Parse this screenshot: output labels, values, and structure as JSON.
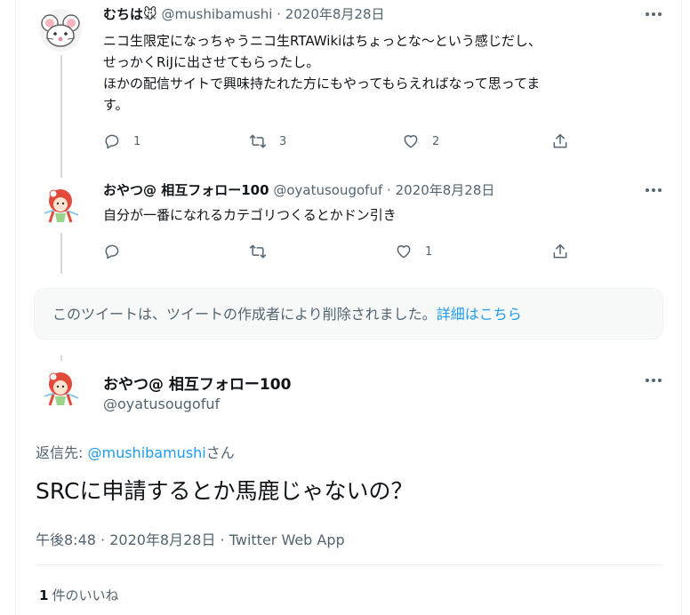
{
  "tweets": [
    {
      "name": "むちは🐭",
      "handle": "@mushibamushi",
      "dot": "·",
      "date": "2020年8月28日",
      "lines": [
        "ニコ生限定になっちゃうニコ生RTAWikiはちょっとな〜という感じだし、",
        "せっかくRiJに出させてもらったし。",
        "ほかの配信サイトで興味持たれた方にもやってもらえればなって思ってま",
        "す。"
      ],
      "reply_count": "1",
      "retweet_count": "3",
      "like_count": "2"
    },
    {
      "name": "おやつ@ 相互フォロー100",
      "handle": "@oyatusougofuf",
      "dot": "·",
      "date": "2020年8月28日",
      "lines": [
        "自分が一番になれるカテゴリつくるとかドン引き"
      ],
      "reply_count": "",
      "retweet_count": "",
      "like_count": "1"
    }
  ],
  "deleted_notice": {
    "text": "このツイートは、ツイートの作成者により削除されました。",
    "link": "詳細はこちら"
  },
  "main_tweet": {
    "name": "おやつ@ 相互フォロー100",
    "handle": "@oyatusougofuf",
    "reply_prefix": "返信先: ",
    "reply_handle": "@mushibamushi",
    "reply_suffix": "さん",
    "text": "SRCに申請するとか馬鹿じゃないの？",
    "time": "午後8:48",
    "date": "2020年8月28日",
    "client": "Twitter Web App",
    "sep": " · ",
    "likes_count": "1",
    "likes_label": "件のいいね"
  },
  "icons": {
    "more": "more-horizontal-icon",
    "reply": "reply-bubble-icon",
    "retweet": "retweet-icon",
    "like": "heart-icon",
    "share": "share-upload-icon"
  },
  "colors": {
    "link": "#1d9bf0",
    "secondary": "#536471",
    "text": "#0f1419",
    "deleted_bg": "#f7f9f9"
  }
}
